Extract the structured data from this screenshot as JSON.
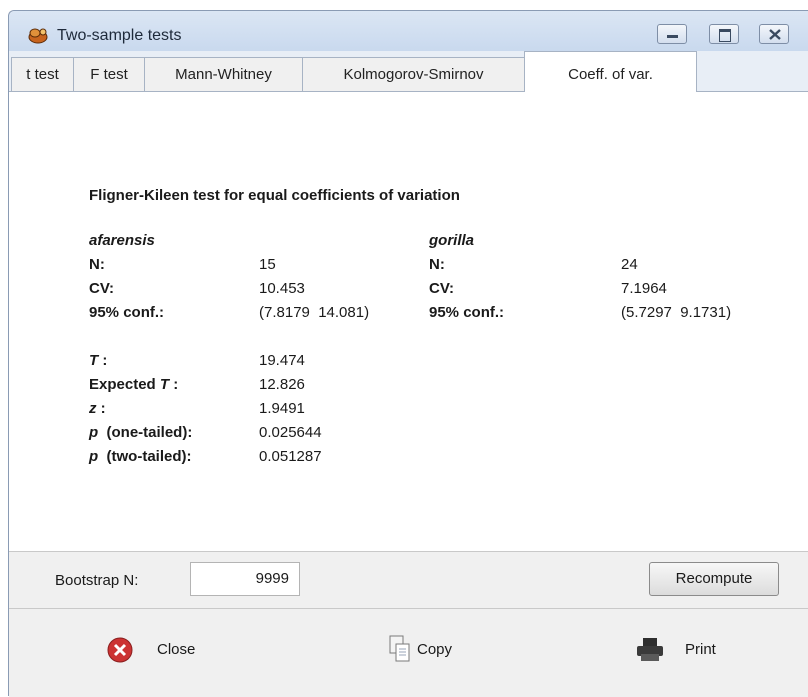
{
  "window": {
    "title": "Two-sample tests",
    "icons": [
      "app-icon",
      "minimize-icon",
      "maximize-icon",
      "close-icon"
    ]
  },
  "tabs": [
    "t test",
    "F test",
    "Mann-Whitney",
    "Kolmogorov-Smirnov",
    "Coeff. of var."
  ],
  "active_tab": "Coeff. of var.",
  "results": {
    "heading": "Fligner-Kileen test for equal coefficients of variation",
    "sample1": {
      "name": "afarensis",
      "n_label": "N:",
      "n": "15",
      "cv_label": "CV:",
      "cv": "10.453",
      "conf_label": "95% conf.:",
      "conf": "(7.8179  14.081)"
    },
    "sample2": {
      "name": "gorilla",
      "n_label": "N:",
      "n": "24",
      "cv_label": "CV:",
      "cv": "7.1964",
      "conf_label": "95% conf.:",
      "conf": "(5.7297  9.1731)"
    },
    "stats": {
      "t_label": "T",
      "t_suffix": " :",
      "t": "19.474",
      "exp_label": "Expected ",
      "exp_t": "T",
      "exp_suffix": " :",
      "exp": "12.826",
      "z_label": "z",
      "z_suffix": " :",
      "z": "1.9491",
      "p1_p": "p",
      "p1_label": "  (one-tailed):",
      "p1": "0.025644",
      "p2_p": "p",
      "p2_label": "  (two-tailed):",
      "p2": "0.051287"
    }
  },
  "bootstrap": {
    "label": "Bootstrap N:",
    "value": "9999"
  },
  "buttons": {
    "recompute": "Recompute",
    "close": "Close",
    "copy": "Copy",
    "print": "Print"
  },
  "colors": {
    "titlebar": "#c9d9ee",
    "close_red": "#cc3333",
    "frame": "#8a9bb4"
  }
}
